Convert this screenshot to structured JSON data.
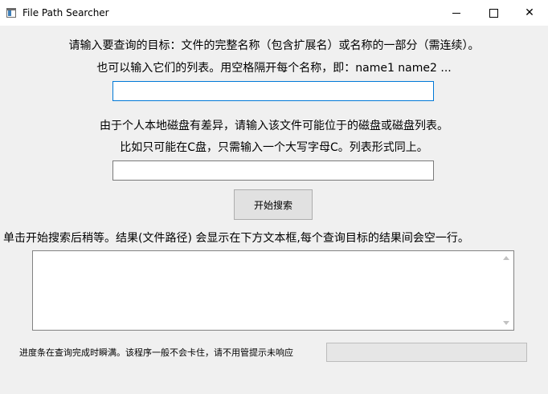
{
  "window": {
    "title": "File Path Searcher",
    "controls": [
      "minimize",
      "maximize",
      "close"
    ]
  },
  "instructions": {
    "line1": "请输入要查询的目标：文件的完整名称（包含扩展名）或名称的一部分（需连续）。",
    "line2": "也可以输入它们的列表。用空格隔开每个名称，即：name1 name2 ...",
    "name_input_value": "",
    "drive_line1": "由于个人本地磁盘有差异，请输入该文件可能位于的磁盘或磁盘列表。",
    "drive_line2": "比如只可能在C盘，只需输入一个大写字母C。列表形式同上。",
    "drive_input_value": ""
  },
  "search_button": {
    "label": "开始搜索"
  },
  "results": {
    "hint": "单击开始搜索后稍等。结果(文件路径) 会显示在下方文本框,每个查询目标的结果间会空一行。",
    "content": ""
  },
  "progress": {
    "label": "进度条在查询完成时瞬满。该程序一般不会卡住，请不用管提示未响应",
    "value": 0
  },
  "icons": {
    "app": "window-app-icon",
    "scroll_up": "scroll-up-arrow-icon",
    "scroll_down": "scroll-down-arrow-icon"
  }
}
